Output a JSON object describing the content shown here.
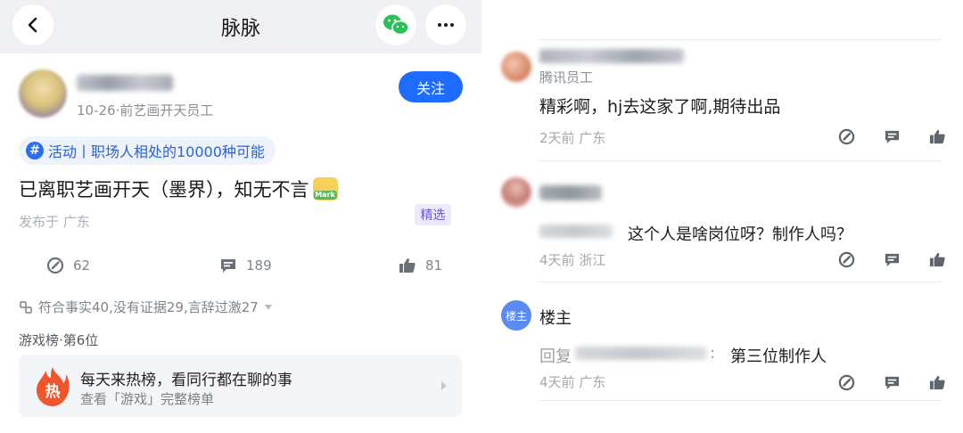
{
  "header": {
    "title": "脉脉"
  },
  "post": {
    "meta": "10-26·前艺画开天员工",
    "follow_label": "关注",
    "tag_label": "活动丨职场人相处的10000种可能",
    "body": "已离职艺画开天（墨界），知无不言",
    "location": "发布于 广东",
    "featured_label": "精选",
    "stats": {
      "edit_count": "62",
      "comment_count": "189",
      "like_count": "81"
    },
    "fact_summary": "符合事实40,没有证据29,言辞过激27",
    "rank_label": "游戏榜·第6位",
    "hot_card": {
      "title": "每天来热榜，看同行都在聊的事",
      "subtitle": "查看「游戏」完整榜单",
      "icon_glyph": "热"
    }
  },
  "comments": [
    {
      "role": "腾讯员工",
      "text": "精彩啊，hj去这家了啊,期待出品",
      "meta": "2天前  广东"
    },
    {
      "text": "这个人是啥岗位呀？制作人吗？",
      "meta": "4天前  浙江"
    },
    {
      "author": "楼主",
      "avatar_label": "楼主",
      "reply_prefix": "回复",
      "reply_colon": ":",
      "text": "第三位制作人",
      "meta": "4天前  广东"
    }
  ],
  "colors": {
    "accent": "#1e6bff",
    "tag_bg": "#edf2fb",
    "hot": "#f2552c"
  }
}
